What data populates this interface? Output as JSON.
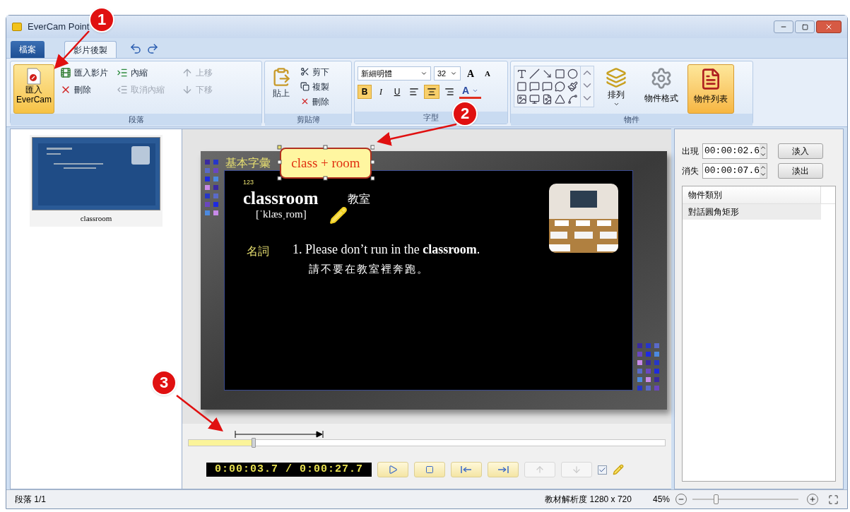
{
  "window": {
    "title": "EverCam Point"
  },
  "tabs": [
    {
      "label": "檔案",
      "kind": "file",
      "selected": false
    },
    {
      "label": "影片後製",
      "kind": "ribbon",
      "selected": true
    }
  ],
  "ribbon": {
    "paragraph": {
      "label": "段落",
      "import_evercam": {
        "label_lines": [
          "匯入",
          "EverCam"
        ],
        "selected": true
      },
      "import_video": {
        "label": "匯入影片",
        "disabled": false
      },
      "delete": {
        "label": "刪除",
        "disabled": false
      },
      "indent": {
        "label": "內縮",
        "disabled": false
      },
      "outdent": {
        "label": "取消內縮",
        "disabled": true
      },
      "move_up": {
        "label": "上移",
        "disabled": true
      },
      "move_down": {
        "label": "下移",
        "disabled": true
      }
    },
    "clipboard": {
      "label": "剪貼簿",
      "paste": {
        "label": "貼上"
      },
      "cut": {
        "label": "剪下"
      },
      "copy": {
        "label": "複製"
      },
      "delete": {
        "label": "刪除"
      }
    },
    "font": {
      "label": "字型",
      "font_name": "新細明體",
      "font_size": "32",
      "grow": "A",
      "shrink": "A",
      "styles": [
        {
          "label": "B",
          "kind": "bold",
          "selected": true
        },
        {
          "label": "I",
          "kind": "italic",
          "selected": false
        },
        {
          "label": "U",
          "kind": "underline",
          "selected": false
        }
      ],
      "align": [
        {
          "kind": "left",
          "selected": false
        },
        {
          "kind": "center",
          "selected": true
        },
        {
          "kind": "right",
          "selected": false
        }
      ],
      "font_color": "A"
    },
    "objects": {
      "label": "物件",
      "arrange": {
        "label": "排列"
      },
      "format": {
        "label": "物件格式"
      },
      "object_list": {
        "label": "物件列表",
        "selected": true
      }
    }
  },
  "slides": [
    {
      "caption": "classroom",
      "selected": true
    }
  ],
  "slide": {
    "heading": "基本字彙",
    "callout": "class + room",
    "index": "123",
    "word": "classroom",
    "meaning": "教室",
    "phonetic": "[ˈklæsˌrom]",
    "part_of_speech": "名詞",
    "example": "1. Please don’t run in the **classroom**.",
    "translation": "請不要在教室裡奔跑。"
  },
  "timeline": {
    "level": 0.137,
    "time": "0:00:03.7 / 0:00:27.7",
    "buttons": [
      {
        "kind": "play",
        "disabled": false
      },
      {
        "kind": "stop",
        "disabled": false
      },
      {
        "kind": "previous",
        "disabled": false
      },
      {
        "kind": "next",
        "disabled": false
      },
      {
        "kind": "up",
        "disabled": true
      },
      {
        "kind": "down",
        "disabled": true
      }
    ],
    "show_pen": {
      "checked": true
    }
  },
  "properties": {
    "appear": {
      "label": "出現",
      "value": "00:00:02.6",
      "button": "淡入"
    },
    "disappear": {
      "label": "消失",
      "value": "00:00:07.6",
      "button": "淡出"
    },
    "object_list": {
      "columns": [
        "物件類別"
      ],
      "rows": [
        {
          "cells": [
            "對話圓角矩形"
          ],
          "selected": true
        }
      ]
    }
  },
  "status_bar": {
    "paragraph": "段落 1/1",
    "resolution": "教材解析度 1280 x 720",
    "zoom": "45%",
    "zoom_slider": {
      "level": 0.2
    }
  },
  "annotations": [
    {
      "label": "1"
    },
    {
      "label": "2"
    },
    {
      "label": "3"
    }
  ]
}
